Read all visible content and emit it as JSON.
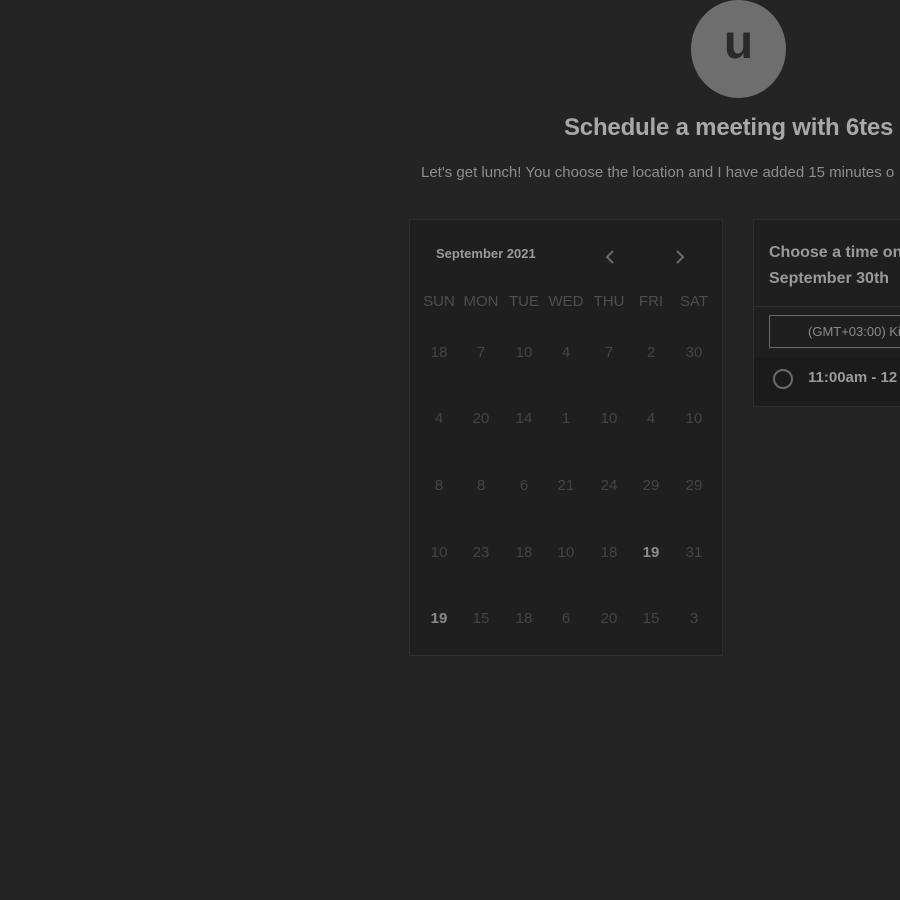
{
  "profile": {
    "avatar_letter": "u",
    "title": "Schedule a meeting with 6tes",
    "subtitle": "Let's get lunch! You choose the location and I have added 15 minutes o"
  },
  "calendar": {
    "month": "September 2021",
    "prev_icon": "chevron-left-icon",
    "next_icon": "chevron-right-icon",
    "weekdays": [
      "SUN",
      "MON",
      "TUE",
      "WED",
      "THU",
      "FRI",
      "SAT"
    ],
    "weeks": [
      [
        "18",
        "7",
        "10",
        "4",
        "7",
        "2",
        "30"
      ],
      [
        "4",
        "20",
        "14",
        "1",
        "10",
        "4",
        "10"
      ],
      [
        "8",
        "8",
        "6",
        "21",
        "24",
        "29",
        "29"
      ],
      [
        "10",
        "23",
        "18",
        "10",
        "18",
        "19",
        "31"
      ],
      [
        "19",
        "15",
        "18",
        "6",
        "20",
        "15",
        "3"
      ]
    ],
    "available": [
      [
        3,
        5
      ],
      [
        4,
        0
      ]
    ]
  },
  "times": {
    "header_line1": "Choose a time on",
    "header_line2": "September 30th",
    "timezone": "(GMT+03:00) Ki",
    "slots": [
      {
        "label": "11:00am - 12"
      }
    ]
  },
  "colors": {
    "background": "#242424",
    "panel": "#1f1f1f",
    "avatar": "#6e6e6e"
  }
}
